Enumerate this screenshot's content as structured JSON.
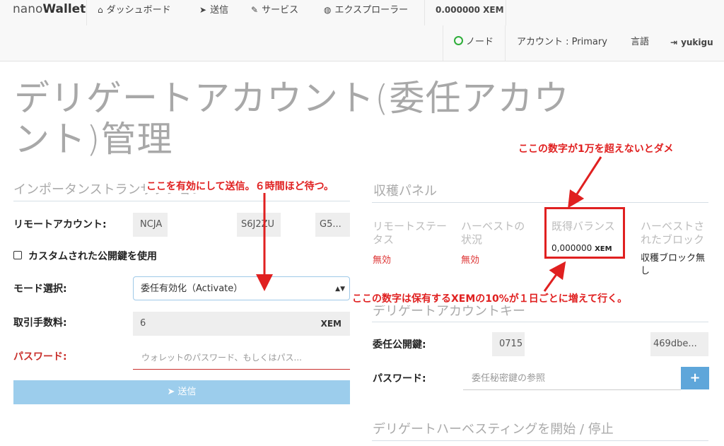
{
  "nav": {
    "brand_prefix": "nano",
    "brand_suffix": "Wallet",
    "dashboard": "ダッシュボード",
    "send": "送信",
    "services": "サービス",
    "explorer": "エクスプローラー",
    "balance": "0.000000 XEM",
    "node": "ノード",
    "account": "アカウント : ",
    "account_name": "Primary",
    "language": "言語",
    "user": "yukigu"
  },
  "page": {
    "title": "デリゲートアカウント(委任アカウント)管理"
  },
  "left": {
    "section_title": "インポータンストランザクション",
    "remote_account_label": "リモートアカウント:",
    "remote_account_value_a": "NCJA",
    "remote_account_value_b": "S6J2ZU",
    "remote_account_value_c": "G5...",
    "custom_pubkey_label": "カスタムされた公開鍵を使用",
    "mode_label": "モード選択:",
    "mode_value": "委任有効化（Activate）",
    "fee_label": "取引手数料:",
    "fee_value": "6",
    "fee_unit": "XEM",
    "password_label": "パスワード:",
    "password_placeholder": "ウォレットのパスワード、もしくはパス...",
    "send_button": "送信"
  },
  "right": {
    "harvest_panel_title": "収穫パネル",
    "remote_status_head": "リモートステータス",
    "remote_status_value": "無効",
    "harvest_status_head": "ハーベストの状況",
    "harvest_status_value": "無効",
    "vested_balance_head": "既得バランス",
    "vested_balance_value": "0,000000",
    "vested_balance_unit": "XEM",
    "harvested_blocks_head": "ハーベストされたブロック",
    "harvested_blocks_value": "収穫ブロック無し",
    "delegate_key_title": "デリゲートアカウントキー",
    "delegate_pubkey_label": "委任公開鍵:",
    "delegate_pubkey_a": "0715",
    "delegate_pubkey_b": "469dbe...",
    "password_label": "パスワード:",
    "password_placeholder": "委任秘密鍵の参照",
    "start_stop_title": "デリゲートハーベスティングを開始 / 停止"
  },
  "annotations": {
    "enable_send": "ここを有効にして送信。６時間ほど待つ。",
    "over_10000": "ここの数字が1万を超えないとダメ",
    "grows_10pct": "ここの数字は保有するXEMの10%が１日ごとに増えて行く。"
  },
  "colors": {
    "accent": "#5ea6da",
    "annotation": "#e02020",
    "status_red": "#d33333"
  }
}
